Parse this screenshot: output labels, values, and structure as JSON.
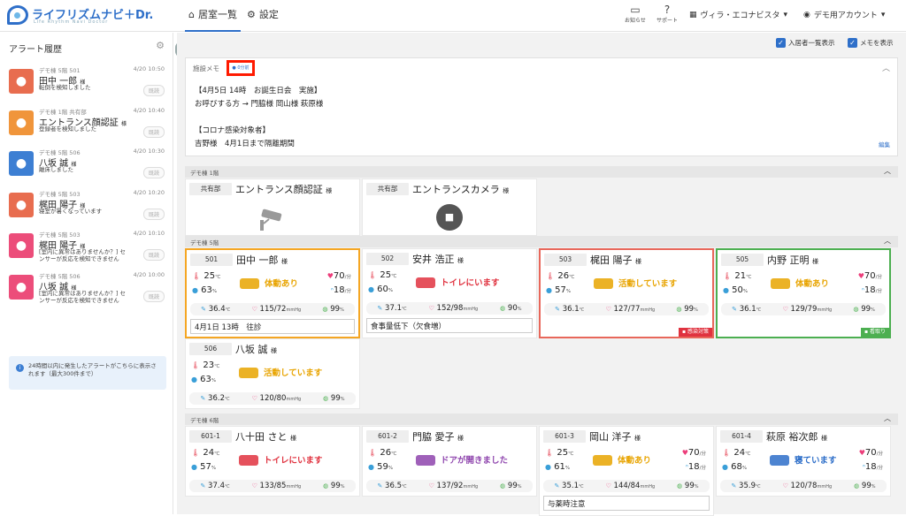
{
  "app": {
    "logo_text": "ライフリズムナビ＋Dr.",
    "logo_sub": "Life Rhythm Navi Doctor"
  },
  "nav": {
    "rooms_tab": "居室一覧",
    "settings_tab": "設定"
  },
  "header": {
    "notice_label": "お知らせ",
    "support_label": "サポート",
    "facility": "ヴィラ・エコナビスタ",
    "account": "デモ用アカウント"
  },
  "sidebar": {
    "title": "アラート履歴",
    "read_label": "既読",
    "info": "24時間以内に発生したアラートがこちらに表示されます（最大300件まで）",
    "alerts": [
      {
        "meta": "デモ棟 5階 501",
        "time": "4/20 10:50",
        "name": "田中 一郎",
        "honorific": "様",
        "msg": "転倒を検知しました",
        "color": "#e86d4f",
        "icon": "fall-icon"
      },
      {
        "meta": "デモ棟 1階 共有部",
        "time": "4/20 10:40",
        "name": "エントランス顔認証",
        "honorific": "様",
        "msg": "登録者を検知しました",
        "color": "#f0953b",
        "icon": "face-recognition-icon"
      },
      {
        "meta": "デモ棟 5階 506",
        "time": "4/20 10:30",
        "name": "八坂 誠",
        "honorific": "様",
        "msg": "離床しました",
        "color": "#3d7fd3",
        "icon": "leave-bed-icon"
      },
      {
        "meta": "デモ棟 5階 503",
        "time": "4/20 10:20",
        "name": "梶田 陽子",
        "honorific": "様",
        "msg": "寝室が暑くなっています",
        "color": "#e86d4f",
        "icon": "temperature-icon"
      },
      {
        "meta": "デモ棟 5階 503",
        "time": "4/20 10:10",
        "name": "梶田 陽子",
        "honorific": "様",
        "msg": "[室内に異常はありませんか？] センサーが反応を検知できません",
        "color": "#ec4d7a",
        "icon": "question-person-icon"
      },
      {
        "meta": "デモ棟 5階 506",
        "time": "4/20 10:00",
        "name": "八坂 誠",
        "honorific": "様",
        "msg": "[室内に異常はありませんか？] センサーが反応を検知できません",
        "color": "#ec4d7a",
        "icon": "question-person-icon"
      }
    ]
  },
  "options": {
    "resident_list": "入居者一覧表示",
    "memo_show": "メモを表示"
  },
  "memo": {
    "title": "施設メモ",
    "badge": "● 0分前",
    "body": "【4月5日 14時　お誕生日会　実施】\nお呼びする方 → 門脇様 岡山様 萩原様\n\n【コロナ感染対象者】\n吉野様　4月1日まで隔離期間",
    "edit": "編集"
  },
  "sections": {
    "f1": "デモ棟 1階",
    "f5": "デモ棟 5階",
    "f6": "デモ棟 6階"
  },
  "shared": [
    {
      "room": "共有部",
      "name": "エントランス顔認証",
      "honorific": "様"
    },
    {
      "room": "共有部",
      "name": "エントランスカメラ",
      "honorific": "様"
    }
  ],
  "residents": [
    {
      "room": "501",
      "name": "田中 一郎",
      "honorific": "様",
      "temp": "25",
      "hum": "63",
      "hr": "70",
      "rr": "18",
      "status": "体動あり",
      "status_color": "#e8a400",
      "body_temp": "36.4",
      "bp": "115/72",
      "spo2": "99",
      "note": "4月1日 13時　往診",
      "flag": ""
    },
    {
      "room": "502",
      "name": "安井 浩正",
      "honorific": "様",
      "temp": "25",
      "hum": "60",
      "hr": "",
      "rr": "",
      "status": "トイレにいます",
      "status_color": "#e0323f",
      "body_temp": "37.1",
      "bp": "152/98",
      "spo2": "90",
      "note": "食事量低下（欠食増）",
      "flag": ""
    },
    {
      "room": "503",
      "name": "梶田 陽子",
      "honorific": "様",
      "temp": "26",
      "hum": "57",
      "hr": "",
      "rr": "",
      "status": "活動しています",
      "status_color": "#e8a400",
      "body_temp": "36.1",
      "bp": "127/77",
      "spo2": "99",
      "note": "",
      "flag": "感染対策"
    },
    {
      "room": "505",
      "name": "内野 正明",
      "honorific": "様",
      "temp": "21",
      "hum": "50",
      "hr": "70",
      "rr": "18",
      "status": "体動あり",
      "status_color": "#e8a400",
      "body_temp": "36.1",
      "bp": "129/79",
      "spo2": "99",
      "note": "",
      "flag": "看取り"
    },
    {
      "room": "506",
      "name": "八坂 誠",
      "honorific": "様",
      "temp": "23",
      "hum": "63",
      "hr": "",
      "rr": "",
      "status": "活動しています",
      "status_color": "#e8a400",
      "body_temp": "36.2",
      "bp": "120/80",
      "spo2": "99",
      "note": "",
      "flag": ""
    },
    {
      "room": "601-1",
      "name": "八十田 さと",
      "honorific": "様",
      "temp": "24",
      "hum": "57",
      "hr": "",
      "rr": "",
      "status": "トイレにいます",
      "status_color": "#e0323f",
      "body_temp": "37.4",
      "bp": "133/85",
      "spo2": "99",
      "note": "",
      "flag": ""
    },
    {
      "room": "601-2",
      "name": "門脇 愛子",
      "honorific": "様",
      "temp": "26",
      "hum": "59",
      "hr": "",
      "rr": "",
      "status": "ドアが開きました",
      "status_color": "#8e44ad",
      "body_temp": "36.5",
      "bp": "137/92",
      "spo2": "99",
      "note": "",
      "flag": ""
    },
    {
      "room": "601-3",
      "name": "岡山 洋子",
      "honorific": "様",
      "temp": "25",
      "hum": "61",
      "hr": "70",
      "rr": "18",
      "status": "体動あり",
      "status_color": "#e8a400",
      "body_temp": "35.1",
      "bp": "144/84",
      "spo2": "99",
      "note": "与薬時注意",
      "flag": ""
    },
    {
      "room": "601-4",
      "name": "萩原 裕次郎",
      "honorific": "様",
      "temp": "24",
      "hum": "68",
      "hr": "70",
      "rr": "18",
      "status": "寝ています",
      "status_color": "#2e6fc9",
      "body_temp": "35.9",
      "bp": "120/78",
      "spo2": "99",
      "note": "",
      "flag": ""
    }
  ],
  "units": {
    "temp": "℃",
    "hum": "%",
    "hr": "/分",
    "rr": "/分",
    "body_temp": "℃",
    "bp": "mmHg",
    "spo2": "%"
  },
  "colors": {
    "accent": "#2e6fc9",
    "infection": "#e0323f",
    "care": "#4caf50",
    "highlight": "#ff1a00"
  }
}
